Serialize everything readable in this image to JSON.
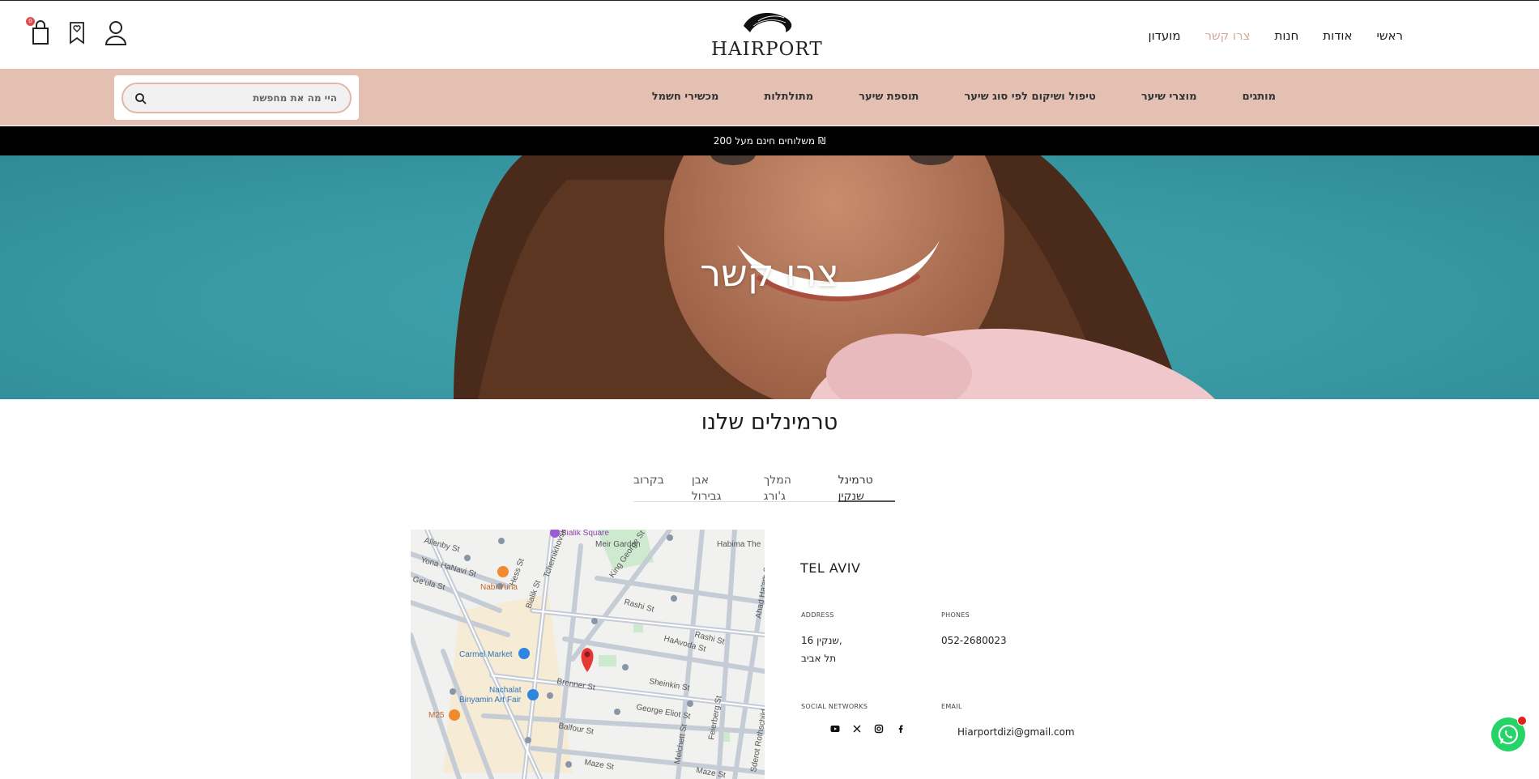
{
  "header": {
    "nav": [
      "ראשי",
      "אודות",
      "חנות",
      "צרו קשר",
      "מועדון"
    ],
    "active_nav": "צרו קשר",
    "logo_text": "HAIRPORT",
    "cart_count": "0"
  },
  "categories": [
    "מותגים",
    "מוצרי שיער",
    "טיפול ושיקום לפי סוג שיער",
    "תוספת שיער",
    "מתולתלות",
    "מכשירי חשמל"
  ],
  "search": {
    "placeholder": "היי מה את מחפשת"
  },
  "promo": {
    "text": "משלוחים חינם מעל 200 ₪"
  },
  "hero": {
    "title": "צרו קשר"
  },
  "terminals": {
    "title": "טרמינלים שלנו",
    "tabs": [
      "טרמינל שנקין",
      "המלך ג'ורג",
      "אבן גבירול",
      "בקרוב"
    ],
    "active_tab": "טרמינל שנקין"
  },
  "map": {
    "labels": [
      "Bialik Square",
      "Meir Garden",
      "Habima The",
      "Allenby St",
      "Yona HaNavi St",
      "Ge'ula St",
      "Nabi Yuna",
      "Rashi St",
      "HaAvoda St",
      "Carmel Market",
      "Nachalat Binyamin Art Fair",
      "Brenner St",
      "Sheinkin St",
      "George Eliot St",
      "Balfour St",
      "M25",
      "Maze St",
      "King George St",
      "Tchernikhovski St",
      "Bialik St",
      "Hess St",
      "Melchett St",
      "Feierberg St",
      "Sderot Rothschild",
      "Ahad Ha'am St"
    ]
  },
  "contact": {
    "city": "TEL AVIV",
    "address_label": "ADDRESS",
    "address_line1": "שנקין 16,",
    "address_line2": "תל אביב",
    "phones_label": "PHONES",
    "phone": "052-2680023",
    "social_label": "SOCIAL NETWORKS",
    "email_label": "EMAIL",
    "email": "Hiarportdizi@gmail.com"
  },
  "social_icons": [
    "youtube-icon",
    "x-icon",
    "instagram-icon",
    "facebook-icon"
  ],
  "colors": {
    "accent": "#e4c0b2",
    "active_link": "#d9a898",
    "hero_bg": "#3a9aa4",
    "whatsapp": "#25d366"
  }
}
